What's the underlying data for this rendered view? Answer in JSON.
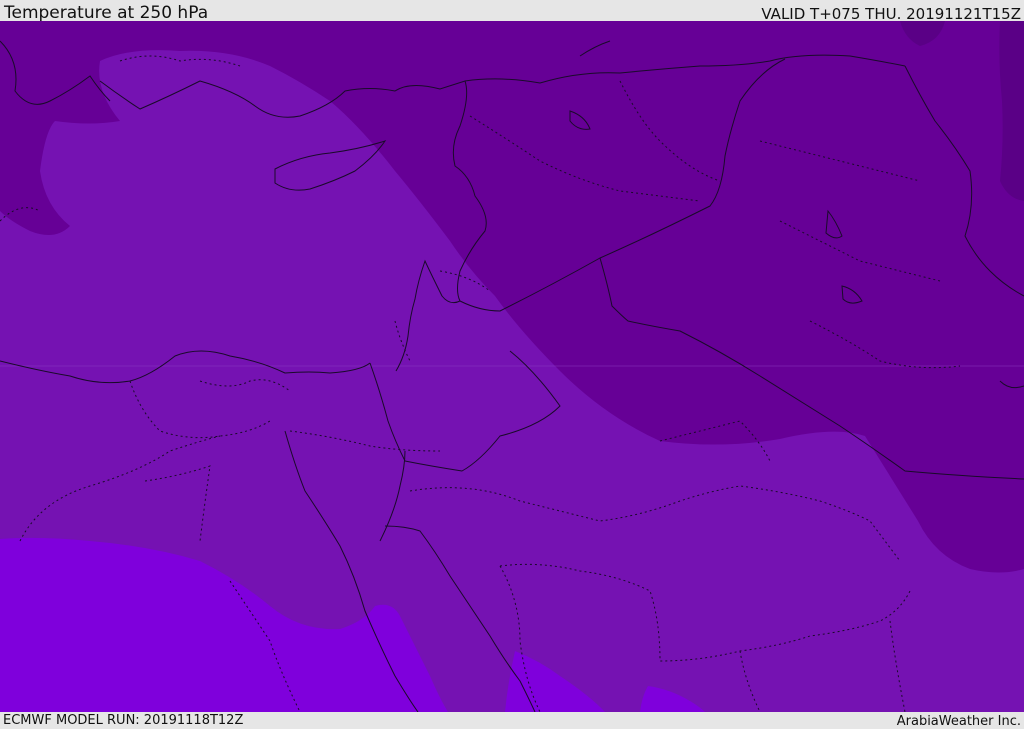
{
  "header": {
    "title": "Temperature at 250 hPa",
    "valid": "VALID T+075 THU. 20191121T15Z"
  },
  "footer": {
    "model_run": "ECMWF MODEL RUN: 20191118T12Z",
    "credit": "ArabiaWeather Inc."
  },
  "map": {
    "fill_colors": {
      "cold_band": "#660096",
      "mid_band": "#7512b2",
      "warm_band": "#7f00dc",
      "darkest_patch": "#5a0086"
    },
    "line_color": "#1a0a2a"
  }
}
